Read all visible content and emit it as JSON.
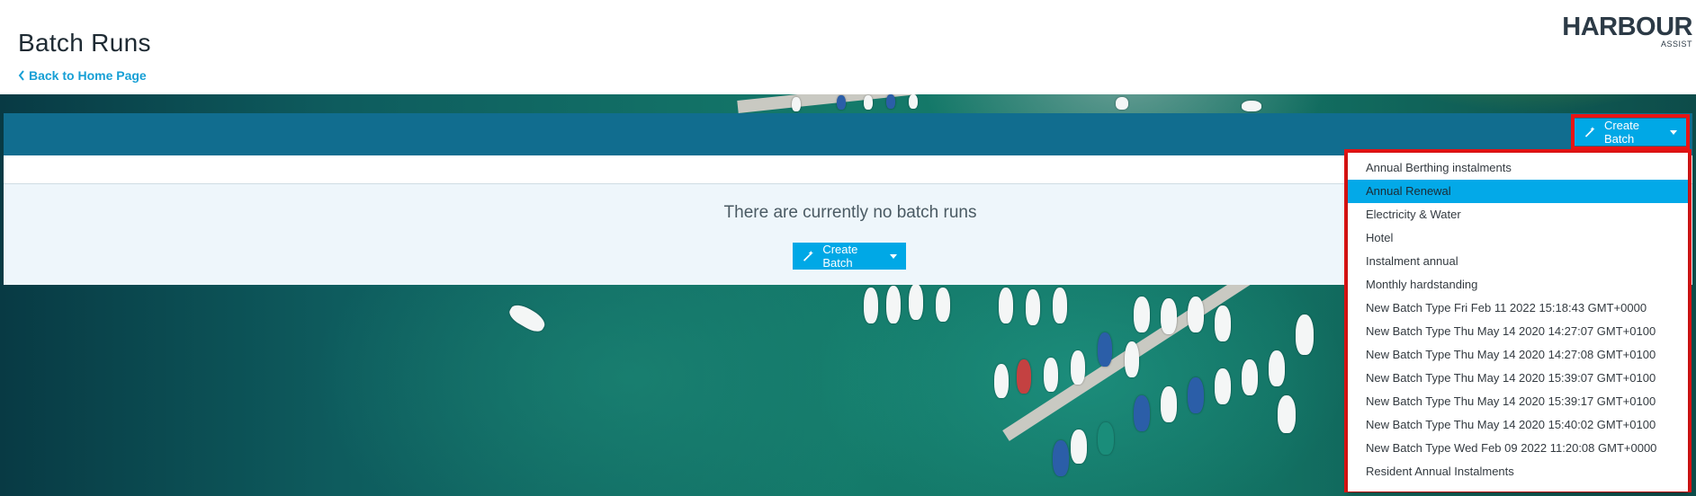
{
  "header": {
    "title": "Batch Runs",
    "back_link": "Back to Home Page",
    "logo_main": "HARBOUR",
    "logo_sub": "ASSIST"
  },
  "toolbar": {
    "create_batch_label": "Create Batch"
  },
  "content": {
    "empty_message": "There are currently no batch runs",
    "create_batch_label": "Create Batch"
  },
  "dropdown": {
    "selected_index": 1,
    "items": [
      "Annual Berthing instalments",
      "Annual Renewal",
      "Electricity & Water",
      "Hotel",
      "Instalment annual",
      "Monthly hardstanding",
      "New Batch Type Fri Feb 11 2022 15:18:43 GMT+0000",
      "New Batch Type Thu May 14 2020 14:27:07 GMT+0100",
      "New Batch Type Thu May 14 2020 14:27:08 GMT+0100",
      "New Batch Type Thu May 14 2020 15:39:07 GMT+0100",
      "New Batch Type Thu May 14 2020 15:39:17 GMT+0100",
      "New Batch Type Thu May 14 2020 15:40:02 GMT+0100",
      "New Batch Type Wed Feb 09 2022 11:20:08 GMT+0000",
      "Resident Annual Instalments"
    ]
  },
  "colors": {
    "accent": "#00a8e6",
    "toolbar": "#116d8f",
    "highlight": "#e81414"
  },
  "icons": {
    "back": "chevron-left-icon",
    "create": "magic-wand-icon",
    "dropdown": "caret-down-icon"
  }
}
